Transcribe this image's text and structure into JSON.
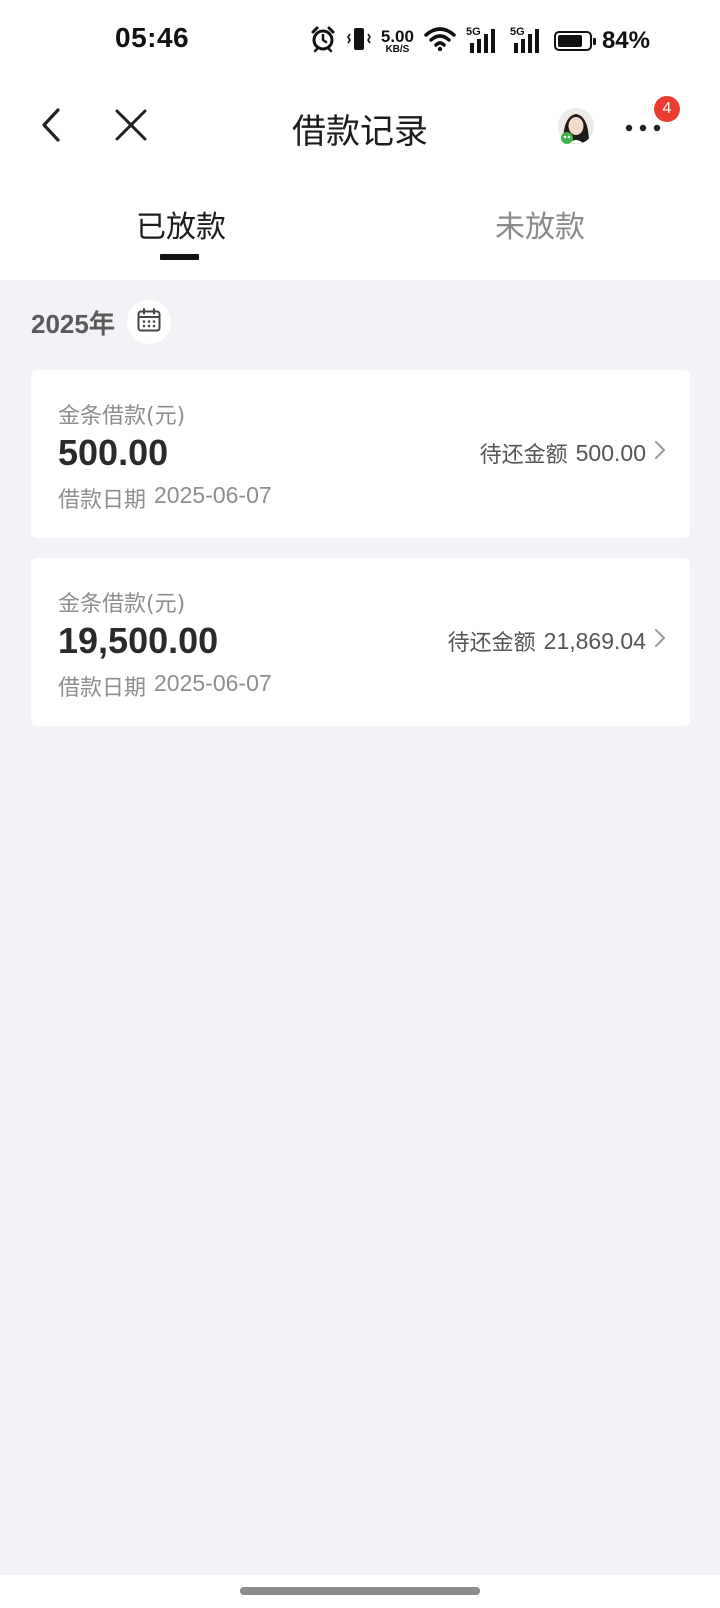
{
  "status_bar": {
    "time": "05:46",
    "net_speed_value": "5.00",
    "net_speed_unit": "KB/S",
    "signal_1_label": "5G",
    "signal_2_label": "5G",
    "battery_percent_text": "84%",
    "battery_level": 0.84
  },
  "nav": {
    "title": "借款记录",
    "more_badge_count": "4"
  },
  "tabs": [
    {
      "label": "已放款",
      "active": true
    },
    {
      "label": "未放款",
      "active": false
    }
  ],
  "year_filter": {
    "year": "2025年"
  },
  "loans": [
    {
      "label": "金条借款(元)",
      "amount": "500.00",
      "date_label": "借款日期",
      "date": "2025-06-07",
      "due_label": "待还金额",
      "due_amount": "500.00"
    },
    {
      "label": "金条借款(元)",
      "amount": "19,500.00",
      "date_label": "借款日期",
      "date": "2025-06-07",
      "due_label": "待还金额",
      "due_amount": "21,869.04"
    }
  ],
  "icons": {
    "back": "chevron-left-icon",
    "close": "close-icon",
    "more": "more-dots-icon",
    "calendar": "calendar-icon",
    "card_arrow": "chevron-right-icon"
  },
  "colors": {
    "background": "#f2f2f7",
    "badge": "#ee3b2f",
    "tab_active": "#1c1c1c",
    "tab_inactive": "#8a8a8a"
  }
}
